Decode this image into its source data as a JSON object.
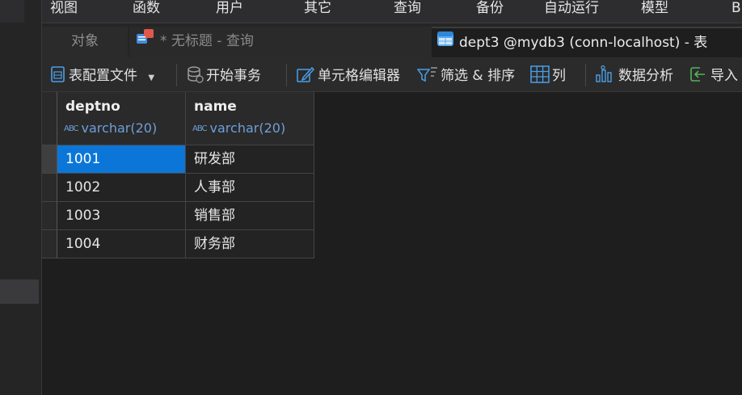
{
  "menubar": {
    "items": [
      "视图",
      "函数",
      "用户",
      "其它",
      "查询",
      "备份",
      "自动运行",
      "模型",
      "B"
    ]
  },
  "tabs": {
    "objects": "对象",
    "query": "* 无标题 - 查询",
    "table": "dept3 @mydb3 (conn-localhost) - 表"
  },
  "toolbar": {
    "profile": "表配置文件",
    "begin_transaction": "开始事务",
    "cell_editor": "单元格编辑器",
    "filter_sort": "筛选 & 排序",
    "columns": "列",
    "data_analysis": "数据分析",
    "import": "导入"
  },
  "grid": {
    "columns": [
      {
        "name": "deptno",
        "type": "varchar(20)"
      },
      {
        "name": "name",
        "type": "varchar(20)"
      }
    ],
    "rows": [
      [
        "1001",
        "研发部"
      ],
      [
        "1002",
        "人事部"
      ],
      [
        "1003",
        "销售部"
      ],
      [
        "1004",
        "财务部"
      ]
    ],
    "type_glyph": "ABC"
  },
  "colors": {
    "selection": "#0b76d8",
    "type_text": "#6f9fd8",
    "background": "#1e1e1e"
  }
}
